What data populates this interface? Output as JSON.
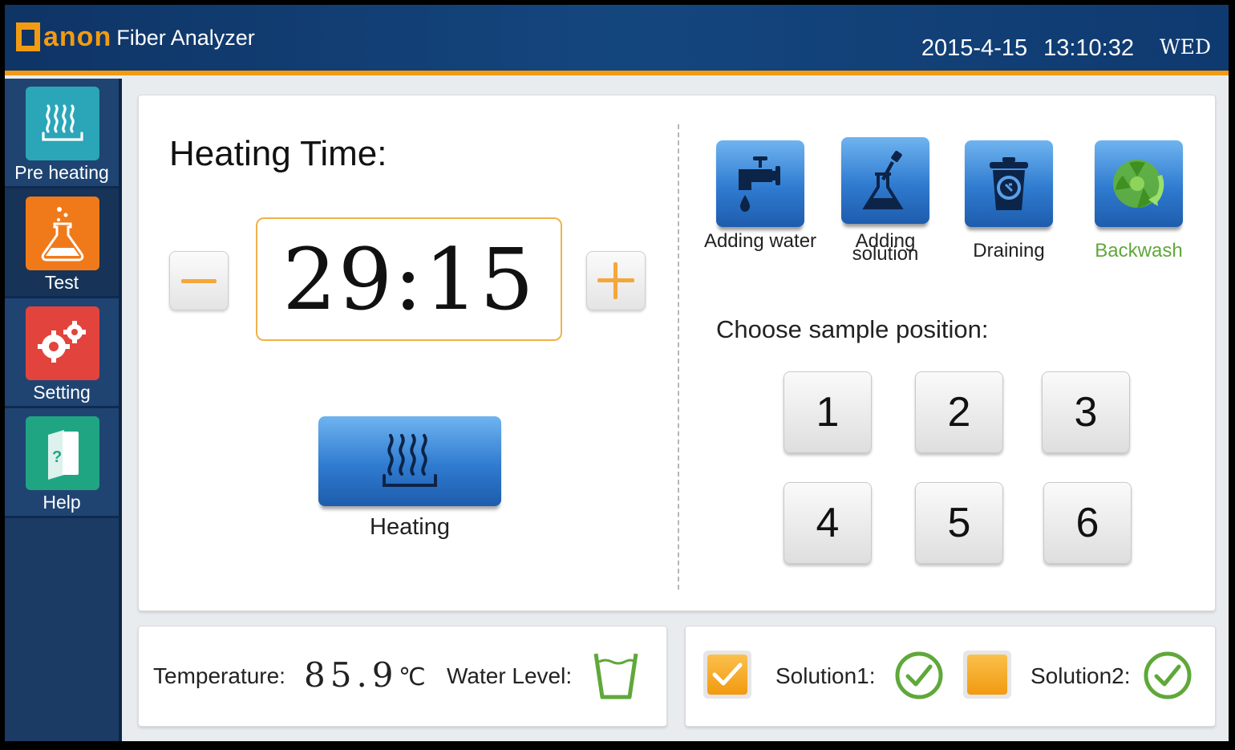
{
  "header": {
    "brand": "anon",
    "product": "Fiber Analyzer",
    "date": "2015-4-15",
    "time": "13:10:32",
    "day": "WED"
  },
  "sidebar": {
    "items": [
      {
        "label": "Pre heating",
        "icon": "heat-waves-icon",
        "color": "#2aa6b8"
      },
      {
        "label": "Test",
        "icon": "flask-icon",
        "color": "#f07a1a"
      },
      {
        "label": "Setting",
        "icon": "gears-icon",
        "color": "#e2443d"
      },
      {
        "label": "Help",
        "icon": "help-book-icon",
        "color": "#20a583"
      }
    ]
  },
  "heating": {
    "title": "Heating Time:",
    "minus_icon": "minus-icon",
    "plus_icon": "plus-icon",
    "timer": "29:15",
    "button_label": "Heating"
  },
  "actions": [
    {
      "label": "Adding water",
      "icon": "faucet-icon"
    },
    {
      "label": "Adding solution",
      "icon": "flask-dropper-icon"
    },
    {
      "label": "Draining",
      "icon": "trash-can-icon"
    },
    {
      "label": "Backwash",
      "icon": "recycle-icon",
      "label_color": "#5fa83a"
    }
  ],
  "sample": {
    "title": "Choose sample position:",
    "positions": [
      "1",
      "2",
      "3",
      "4",
      "5",
      "6"
    ]
  },
  "status": {
    "temperature_label": "Temperature:",
    "temperature_value": "85.9",
    "temperature_unit": "℃",
    "water_level_label": "Water Level:",
    "solution1_label": "Solution1:",
    "solution1_checked": true,
    "solution2_label": "Solution2:",
    "solution2_checked": false,
    "ok_color": "#5fa83a"
  }
}
